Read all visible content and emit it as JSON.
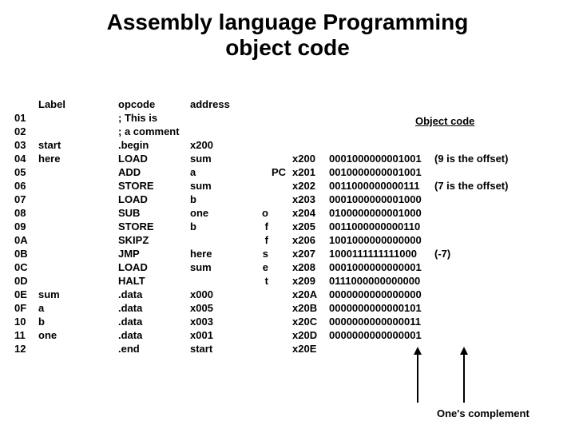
{
  "title_line1": "Assembly  language Programming",
  "title_line2": "object code",
  "headers": {
    "label": "Label",
    "opcode": "opcode",
    "address": "address",
    "object": "Object code"
  },
  "pc_label": "PC",
  "offset_word": "offset",
  "ones_complement": "One's complement",
  "source": [
    {
      "ln": "01",
      "label": "",
      "op": "; This is",
      "addr": ""
    },
    {
      "ln": "02",
      "label": "",
      "op": "; a comment",
      "addr": ""
    },
    {
      "ln": "03",
      "label": "start",
      "op": ".begin",
      "addr": "x200"
    },
    {
      "ln": "04",
      "label": "here",
      "op": "LOAD",
      "addr": "sum"
    },
    {
      "ln": "05",
      "label": "",
      "op": "ADD",
      "addr": "a"
    },
    {
      "ln": "06",
      "label": "",
      "op": "STORE",
      "addr": "sum"
    },
    {
      "ln": "07",
      "label": "",
      "op": "LOAD",
      "addr": "b"
    },
    {
      "ln": "08",
      "label": "",
      "op": "SUB",
      "addr": "one"
    },
    {
      "ln": "09",
      "label": "",
      "op": "STORE",
      "addr": "b"
    },
    {
      "ln": "0A",
      "label": "",
      "op": "SKIPZ",
      "addr": ""
    },
    {
      "ln": "0B",
      "label": "",
      "op": "JMP",
      "addr": "here"
    },
    {
      "ln": "0C",
      "label": "",
      "op": "LOAD",
      "addr": "sum"
    },
    {
      "ln": "0D",
      "label": "",
      "op": "HALT",
      "addr": ""
    },
    {
      "ln": "0E",
      "label": "sum",
      "op": ".data",
      "addr": "x000"
    },
    {
      "ln": "0F",
      "label": "a",
      "op": ".data",
      "addr": "x005"
    },
    {
      "ln": "10",
      "label": "b",
      "op": ".data",
      "addr": "x003"
    },
    {
      "ln": "11",
      "label": "one",
      "op": ".data",
      "addr": "x001"
    },
    {
      "ln": "12",
      "label": "",
      "op": ".end",
      "addr": "start"
    }
  ],
  "object": [
    {
      "mem": "x200",
      "bin": "0001000000001001",
      "note": "(9 is the offset)"
    },
    {
      "mem": "x201",
      "bin": "0010000000001001",
      "note": ""
    },
    {
      "mem": "x202",
      "bin": "0011000000000111",
      "note": "(7 is the offset)"
    },
    {
      "mem": "x203",
      "bin": "0001000000001000",
      "note": ""
    },
    {
      "mem": "x204",
      "bin": "0100000000001000",
      "note": ""
    },
    {
      "mem": "x205",
      "bin": "0011000000000110",
      "note": ""
    },
    {
      "mem": "x206",
      "bin": "1001000000000000",
      "note": ""
    },
    {
      "mem": "x207",
      "bin": "1000111111111000",
      "note": "(-7)"
    },
    {
      "mem": "x208",
      "bin": "0001000000000001",
      "note": ""
    },
    {
      "mem": "x209",
      "bin": "0111000000000000",
      "note": ""
    },
    {
      "mem": "x20A",
      "bin": "0000000000000000",
      "note": ""
    },
    {
      "mem": "x20B",
      "bin": "0000000000000101",
      "note": ""
    },
    {
      "mem": "x20C",
      "bin": "0000000000000011",
      "note": ""
    },
    {
      "mem": "x20D",
      "bin": "0000000000000001",
      "note": ""
    },
    {
      "mem": "x20E",
      "bin": "",
      "note": ""
    }
  ]
}
